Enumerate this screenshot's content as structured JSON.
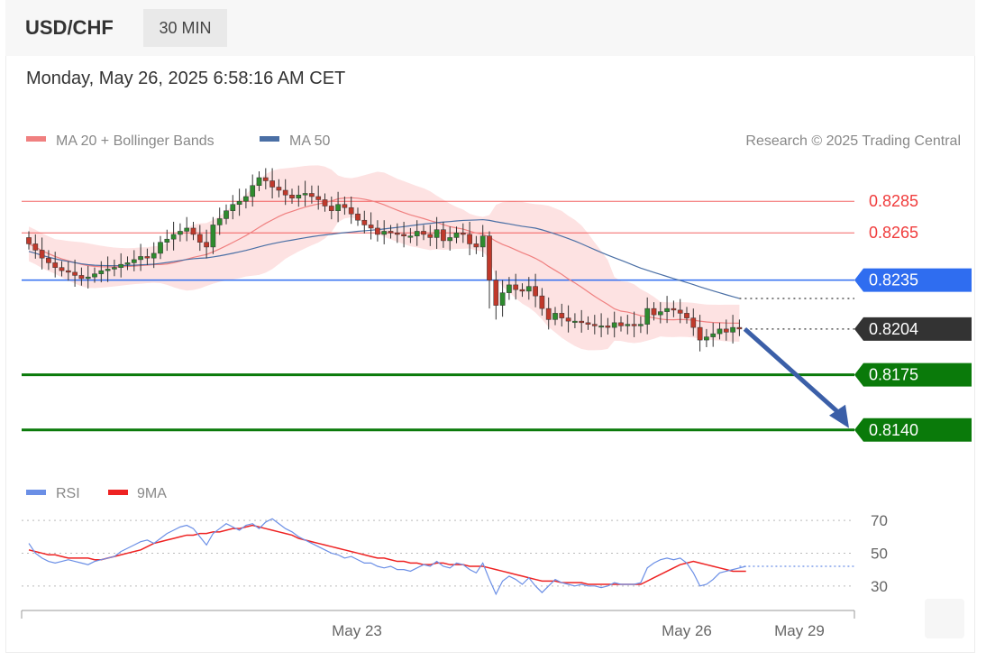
{
  "header": {
    "symbol": "USD/CHF",
    "timeframe": "30 MIN"
  },
  "timestamp": "Monday, May 26, 2025 6:58:16 AM CET",
  "legend": {
    "ma20_label": "MA 20 + Bollinger Bands",
    "ma50_label": "MA 50",
    "copyright": "Research © 2025 Trading Central"
  },
  "colors": {
    "resistance": "#f03c3c",
    "pivot": "#2f6df0",
    "support": "#0a7a0a",
    "current": "#333333",
    "bollinger_fill": "#fde2e2",
    "ma20": "#f08080",
    "ma50": "#4a6fa5",
    "candle_up": "#2e8b2e",
    "candle_down": "#c0392b",
    "arrow": "#3b5fa8",
    "rsi": "#6b8fe6",
    "rsi_ma": "#ee2222"
  },
  "chart_data": [
    {
      "type": "candlestick",
      "title": "USD/CHF",
      "x_ticks": [
        "May 23",
        "May 26",
        "May 29"
      ],
      "ylim": [
        0.8129,
        0.8304
      ],
      "levels": [
        {
          "value": "0.8285",
          "kind": "resistance"
        },
        {
          "value": "0.8265",
          "kind": "resistance"
        },
        {
          "value": "0.8235",
          "kind": "pivot"
        },
        {
          "value": "0.8204",
          "kind": "current"
        },
        {
          "value": "0.8175",
          "kind": "support"
        },
        {
          "value": "0.8140",
          "kind": "support"
        }
      ],
      "series": [
        {
          "name": "MA 20 + Bollinger Bands"
        },
        {
          "name": "MA 50"
        }
      ],
      "close": [
        0.8258,
        0.8254,
        0.8249,
        0.8246,
        0.8243,
        0.8241,
        0.824,
        0.8238,
        0.8236,
        0.8237,
        0.8239,
        0.8241,
        0.8242,
        0.8243,
        0.8245,
        0.8246,
        0.8248,
        0.825,
        0.8249,
        0.8252,
        0.8259,
        0.8261,
        0.8264,
        0.8266,
        0.8268,
        0.8264,
        0.8259,
        0.8256,
        0.827,
        0.8274,
        0.8279,
        0.8283,
        0.8285,
        0.8288,
        0.8295,
        0.83,
        0.8298,
        0.8294,
        0.8292,
        0.8289,
        0.8287,
        0.8289,
        0.829,
        0.8288,
        0.8286,
        0.8282,
        0.8279,
        0.8283,
        0.8281,
        0.8277,
        0.8273,
        0.827,
        0.8268,
        0.8264,
        0.8266,
        0.8265,
        0.8264,
        0.8263,
        0.8263,
        0.8266,
        0.8264,
        0.8262,
        0.8267,
        0.826,
        0.8262,
        0.8265,
        0.8264,
        0.8258,
        0.8256,
        0.8263,
        0.8235,
        0.8219,
        0.8227,
        0.8232,
        0.8229,
        0.8228,
        0.8231,
        0.8225,
        0.8217,
        0.821,
        0.8214,
        0.8211,
        0.8209,
        0.8209,
        0.8208,
        0.8207,
        0.8206,
        0.8206,
        0.8205,
        0.8208,
        0.8206,
        0.8207,
        0.8206,
        0.8207,
        0.8217,
        0.8213,
        0.8215,
        0.8217,
        0.8216,
        0.8214,
        0.8211,
        0.8205,
        0.8197,
        0.8199,
        0.8201,
        0.8204,
        0.8202,
        0.8205,
        0.8204
      ],
      "rsi_ylim": [
        20,
        75
      ],
      "rsi_ticks": [
        70,
        50,
        30
      ],
      "rsi": [
        56,
        50,
        47,
        45,
        44,
        45,
        46,
        45,
        44,
        43,
        45,
        46,
        47,
        48,
        51,
        53,
        55,
        57,
        58,
        56,
        59,
        62,
        64,
        66,
        67,
        65,
        60,
        55,
        62,
        65,
        68,
        66,
        64,
        67,
        68,
        65,
        69,
        71,
        68,
        65,
        63,
        60,
        58,
        56,
        54,
        52,
        50,
        49,
        47,
        48,
        46,
        44,
        44,
        42,
        41,
        42,
        40,
        40,
        39,
        41,
        43,
        42,
        45,
        42,
        41,
        44,
        43,
        40,
        38,
        44,
        34,
        25,
        33,
        36,
        34,
        31,
        35,
        30,
        26,
        30,
        34,
        32,
        31,
        30,
        31,
        30,
        30,
        29,
        30,
        32,
        31,
        31,
        31,
        32,
        41,
        44,
        46,
        47,
        46,
        47,
        44,
        38,
        30,
        31,
        34,
        38,
        39,
        40,
        41,
        42
      ],
      "rsi_ma": [
        52,
        51,
        50,
        49,
        49,
        48,
        47,
        47,
        47,
        47,
        46,
        46,
        47,
        48,
        49,
        50,
        51,
        52,
        54,
        56,
        57,
        58,
        59,
        60,
        61,
        61,
        62,
        62,
        63,
        63,
        64,
        65,
        65,
        66,
        67,
        66,
        65,
        64,
        63,
        62,
        61,
        59,
        58,
        57,
        56,
        55,
        54,
        53,
        52,
        51,
        50,
        49,
        48,
        47,
        47,
        46,
        45,
        45,
        44,
        44,
        43,
        43,
        44,
        44,
        43,
        43,
        43,
        42,
        42,
        42,
        41,
        40,
        39,
        38,
        37,
        36,
        35,
        34,
        33,
        33,
        33,
        32,
        32,
        32,
        32,
        31,
        31,
        31,
        31,
        31,
        31,
        31,
        31,
        31,
        33,
        35,
        37,
        39,
        41,
        43,
        44,
        45,
        44,
        43,
        42,
        41,
        40,
        39,
        39,
        39
      ]
    }
  ]
}
